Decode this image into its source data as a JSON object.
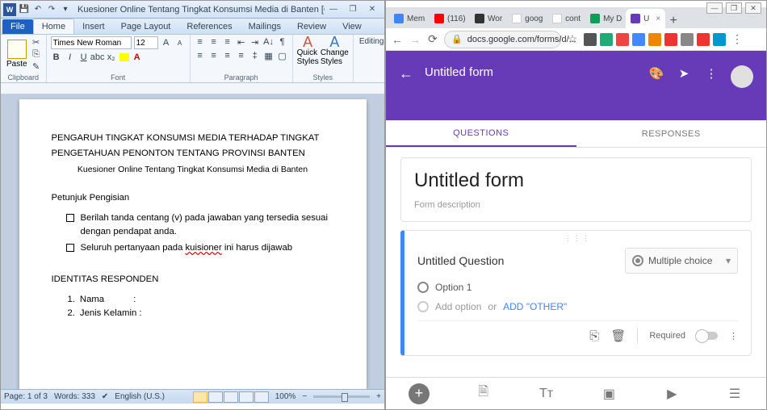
{
  "word": {
    "title": "Kuesioner Online Tentang Tingkat Konsumsi Media di Banten [Compatibility ...",
    "qat": [
      "💾",
      "↶",
      "↷"
    ],
    "tabs": [
      "File",
      "Home",
      "Insert",
      "Page Layout",
      "References",
      "Mailings",
      "Review",
      "View"
    ],
    "active_tab": "Home",
    "font_name": "Times New Roman",
    "font_size": "12",
    "groups": {
      "clipboard": "Clipboard",
      "font": "Font",
      "paragraph": "Paragraph",
      "styles": "Styles",
      "editing": "Editing"
    },
    "paste_label": "Paste",
    "quick_styles": "Quick Styles",
    "change_styles": "Change Styles",
    "doc": {
      "title_line1": "PENGARUH TINGKAT KONSUMSI MEDIA TERHADAP TINGKAT",
      "title_line2": "PENGETAHUAN PENONTON TENTANG PROVINSI BANTEN",
      "subtitle": "Kuesioner Online Tentang Tingkat Konsumsi Media di Banten",
      "section1": "Petunjuk Pengisian",
      "instr1": "Berilah tanda centang (v) pada jawaban yang tersedia sesuai dengan pendapat anda.",
      "instr2a": "Seluruh pertanyaan pada ",
      "instr2b": "kuisioner",
      "instr2c": " ini harus dijawab",
      "section2": "IDENTITAS RESPONDEN",
      "item1_n": "1.",
      "item1": "Nama",
      "item2_n": "2.",
      "item2": "Jenis Kelamin :"
    },
    "status": {
      "page": "Page: 1 of 3",
      "words": "Words: 333",
      "lang": "English (U.S.)",
      "zoom": "100%"
    }
  },
  "chrome": {
    "tabs": [
      {
        "label": "Mem",
        "color": "#4285f4"
      },
      {
        "label": "(116)",
        "color": "#ff0000"
      },
      {
        "label": "Wor",
        "color": "#333"
      },
      {
        "label": "goog",
        "color": "#4285f4"
      },
      {
        "label": "cont",
        "color": "#4285f4"
      },
      {
        "label": "My D",
        "color": "#0f9d58"
      },
      {
        "label": "U",
        "color": "#673ab7",
        "active": true
      }
    ],
    "url": "docs.google.com/forms/d/...",
    "ext_colors": [
      "#555",
      "#2a7",
      "#e44",
      "#48f",
      "#e80",
      "#e33",
      "#888",
      "#e33",
      "#09c"
    ]
  },
  "forms": {
    "header_title": "Untitled form",
    "tabs": {
      "q": "QUESTIONS",
      "r": "RESPONSES"
    },
    "form_title": "Untitled form",
    "form_desc": "Form description",
    "question": "Untitled Question",
    "q_type": "Multiple choice",
    "opt1": "Option 1",
    "add_option": "Add option",
    "or": "  or  ",
    "add_other": "ADD \"OTHER\"",
    "required": "Required"
  }
}
